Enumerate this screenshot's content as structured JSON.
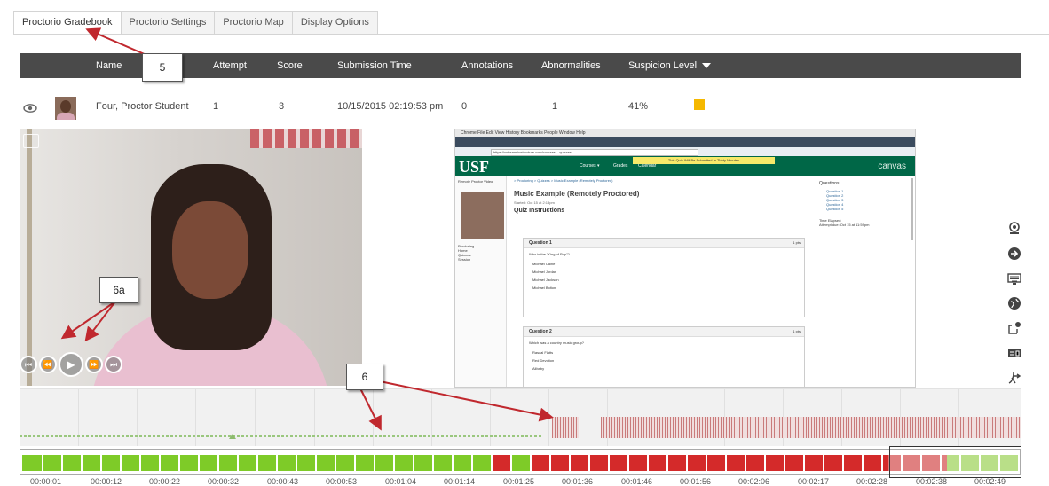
{
  "tabs": [
    {
      "label": "Proctorio Gradebook",
      "active": true
    },
    {
      "label": "Proctorio Settings",
      "active": false
    },
    {
      "label": "Proctorio Map",
      "active": false
    },
    {
      "label": "Display Options",
      "active": false
    }
  ],
  "table": {
    "headers": {
      "name": "Name",
      "attempt": "Attempt",
      "score": "Score",
      "submission_time": "Submission Time",
      "annotations": "Annotations",
      "abnormalities": "Abnormalities",
      "suspicion_level": "Suspicion Level"
    },
    "row": {
      "name": "Four, Proctor Student",
      "attempt": "1",
      "score": "3",
      "submission_time": "10/15/2015 02:19:53 pm",
      "annotations": "0",
      "abnormalities": "1",
      "suspicion": "41%",
      "suspicion_color": "#f5b800"
    }
  },
  "callouts": {
    "c5": "5",
    "c6a": "6a",
    "c6": "6"
  },
  "screen_capture": {
    "menubar": "Chrome   File   Edit   View   History   Bookmarks   People   Window   Help",
    "url": "https://usflearn.instructure.com/courses/...quizzes/...",
    "yellow_banner": "This Quiz Will Be Submitted In Thirty Minutes",
    "logo": "USF",
    "nav_courses": "Courses ▾",
    "nav_grades": "Grades",
    "nav_calendar": "Calendar",
    "canvas_word": "canvas",
    "side_title": "Remote Proctor Video",
    "side_items": [
      "Proctoring",
      "Home",
      "Quizzes",
      "Session"
    ],
    "crumb": "> Proctoring > Quizzes > Music Example (Remotely Proctored)",
    "title": "Music Example (Remotely Proctored)",
    "started": "Started: Oct 15 at 2:18pm",
    "quiz_instructions": "Quiz Instructions",
    "q1": {
      "label": "Question 1",
      "pts": "1 pts",
      "text": "Who is the \"King of Pop\"?",
      "options": [
        "Michael Caine",
        "Michael Jordan",
        "Michael Jackson",
        "Michael Bolton"
      ]
    },
    "q2": {
      "label": "Question 2",
      "pts": "1 pts",
      "text": "Which was a country music group?",
      "options": [
        "Rascal Flatts",
        "Red Devotion",
        "Alibaby"
      ]
    },
    "questions_panel": {
      "title": "Questions",
      "items": [
        "Question 1",
        "Question 2",
        "Question 3",
        "Question 4",
        "Question 5"
      ],
      "time_elapsed": "Time Elapsed:",
      "note": "Attempt due: Oct 15 at 11:59pm"
    }
  },
  "video_controls": {
    "rewind": "⏮",
    "back": "⏪",
    "play": "▶",
    "forward": "⏩",
    "end": "⏭"
  },
  "right_icons": [
    "webcam-icon",
    "login-icon",
    "keyboard-icon",
    "globe-icon",
    "clipboard-icon",
    "display-icon",
    "download-icon"
  ],
  "timeline": {
    "ticks": [
      "00:00:01",
      "00:00:12",
      "00:00:22",
      "00:00:32",
      "00:00:43",
      "00:00:53",
      "00:01:04",
      "00:01:14",
      "00:01:25",
      "00:01:36",
      "00:01:46",
      "00:01:56",
      "00:02:06",
      "00:02:17",
      "00:02:28",
      "00:02:38",
      "00:02:49"
    ],
    "colors": {
      "green": "#7ecb28",
      "red": "#d42a2a",
      "pale_red": "#e08080",
      "pale_green": "#b9df88"
    }
  }
}
